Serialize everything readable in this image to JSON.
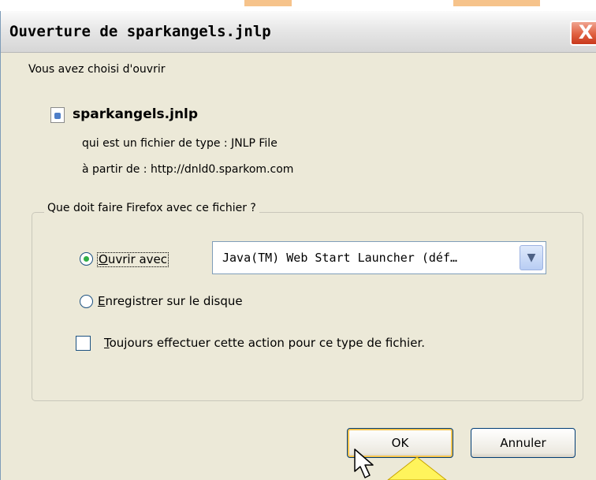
{
  "dialog": {
    "title": "Ouverture de sparkangels.jnlp",
    "close_label": "X",
    "intro": "Vous avez choisi d'ouvrir",
    "file": {
      "name": "sparkangels.jnlp",
      "type_line": "qui est un fichier de type :  JNLP File",
      "from_line": "à partir de :  http://dnld0.sparkom.com"
    },
    "group": {
      "legend": "Que doit faire Firefox avec ce fichier ?",
      "open_with": {
        "first_char": "O",
        "rest": "uvrir avec",
        "checked": true,
        "app_value": "Java(TM) Web Start Launcher (déf…"
      },
      "save_to_disk": {
        "first_char": "E",
        "rest": "nregistrer sur le disque",
        "checked": false
      },
      "always": {
        "first_char": "T",
        "rest": "oujours effectuer cette action pour ce type de fichier.",
        "checked": false
      }
    },
    "buttons": {
      "ok": "OK",
      "cancel": "Annuler"
    },
    "accent": {
      "radio_checked": "#2fae46",
      "close_button": "#e06040",
      "default_button_focus": "#f5c44e",
      "callout": "#fff45c"
    }
  }
}
